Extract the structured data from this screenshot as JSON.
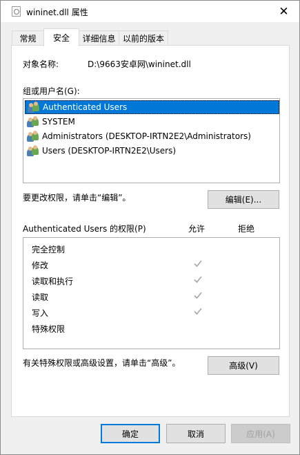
{
  "window": {
    "title": "wininet.dll 属性",
    "close_glyph": "✕"
  },
  "tabs": [
    {
      "label": "常规",
      "active": false
    },
    {
      "label": "安全",
      "active": true
    },
    {
      "label": "详细信息",
      "active": false
    },
    {
      "label": "以前的版本",
      "active": false
    }
  ],
  "security": {
    "object_name_label": "对象名称:",
    "object_name_value": "D:\\9663安卓网\\wininet.dll",
    "groups_label": "组或用户名(G):",
    "users": [
      {
        "name": "Authenticated Users",
        "selected": true,
        "icon": "user-group-icon"
      },
      {
        "name": "SYSTEM",
        "selected": false,
        "icon": "user-group-icon"
      },
      {
        "name": "Administrators (DESKTOP-IRTN2E2\\Administrators)",
        "selected": false,
        "icon": "user-group-icon"
      },
      {
        "name": "Users (DESKTOP-IRTN2E2\\Users)",
        "selected": false,
        "icon": "user-group-icon"
      }
    ],
    "edit_hint": "要更改权限，请单击“编辑”。",
    "edit_button": "编辑(E)...",
    "permissions_label": "Authenticated Users 的权限(P)",
    "allow_header": "允许",
    "deny_header": "拒绝",
    "permissions": [
      {
        "name": "完全控制",
        "allow": false
      },
      {
        "name": "修改",
        "allow": true
      },
      {
        "name": "读取和执行",
        "allow": true
      },
      {
        "name": "读取",
        "allow": true
      },
      {
        "name": "写入",
        "allow": true
      },
      {
        "name": "特殊权限",
        "allow": false
      }
    ],
    "advanced_hint": "有关特殊权限或高级设置，请单击“高级”。",
    "advanced_button": "高级(V)"
  },
  "footer": {
    "ok": "确定",
    "cancel": "取消",
    "apply": "应用(A)"
  },
  "colors": {
    "selection": "#0078d7",
    "check": "#a6a6a6"
  }
}
